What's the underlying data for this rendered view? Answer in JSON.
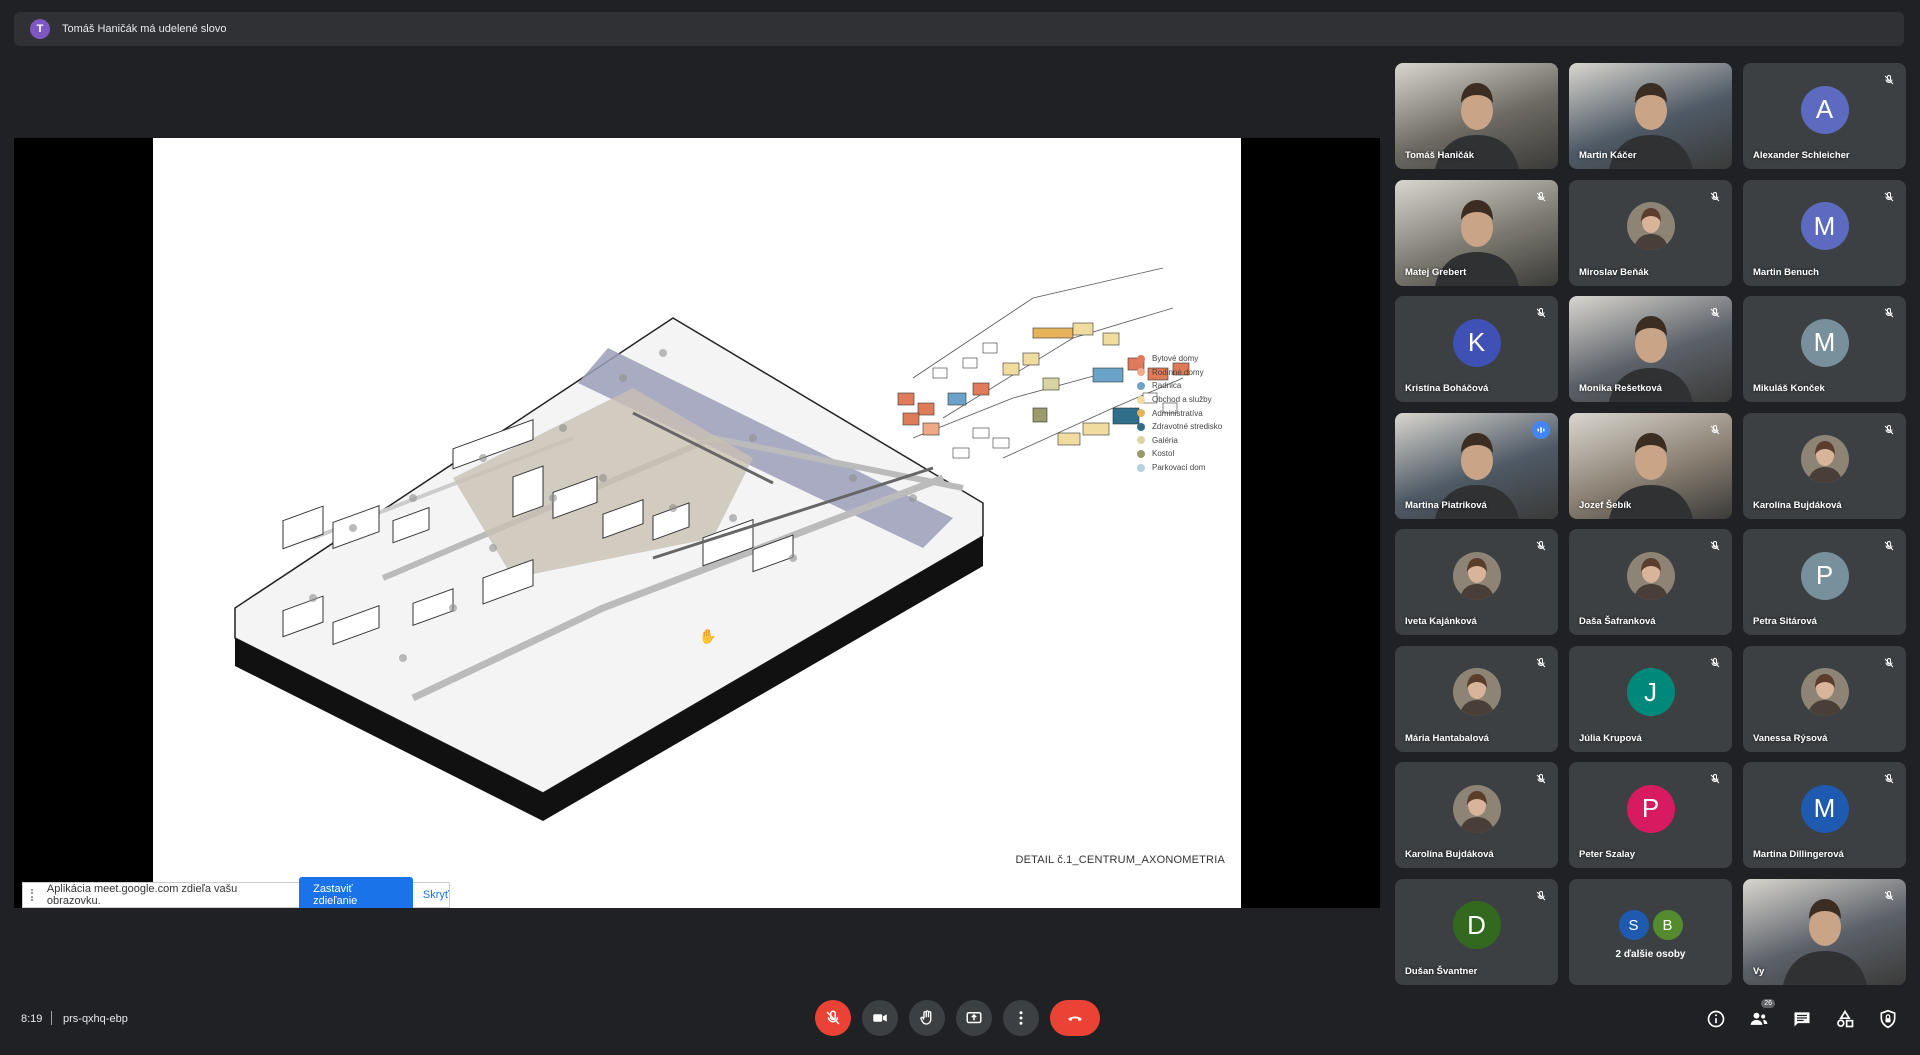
{
  "banner": {
    "avatar_letter": "T",
    "text": "Tomáš Haničák má udelené slovo"
  },
  "slide": {
    "caption": "DETAIL č.1_CENTRUM_AXONOMETRIA",
    "legend": [
      {
        "label": "Bytové domy",
        "color": "#e07b5a"
      },
      {
        "label": "Rodinné domy",
        "color": "#f0a887"
      },
      {
        "label": "Radnica",
        "color": "#6aa3c7"
      },
      {
        "label": "Obchod a služby",
        "color": "#f1dca0"
      },
      {
        "label": "Administratíva",
        "color": "#e6b35a"
      },
      {
        "label": "Zdravotné stredisko",
        "color": "#2f6f8a"
      },
      {
        "label": "Galéria",
        "color": "#d8d3a0"
      },
      {
        "label": "Kostol",
        "color": "#9a9a6a"
      },
      {
        "label": "Parkovací dom",
        "color": "#b6cfdc"
      }
    ]
  },
  "share_bar": {
    "text": "Aplikácia meet.google.com zdieľa vašu obrazovku.",
    "stop_label": "Zastaviť zdieľanie",
    "hide_label": "Skryť"
  },
  "participants": [
    {
      "name": "Tomáš Haničák",
      "type": "video",
      "muted": false
    },
    {
      "name": "Martin Káčer",
      "type": "video",
      "muted": false
    },
    {
      "name": "Alexander Schleicher",
      "type": "letter",
      "letter": "A",
      "color": "#5c6bc0",
      "muted": true
    },
    {
      "name": "Matej Grebert",
      "type": "video",
      "muted": true
    },
    {
      "name": "Miroslav Beňák",
      "type": "photo",
      "muted": true
    },
    {
      "name": "Martin Benuch",
      "type": "letter",
      "letter": "M",
      "color": "#5c6bc0",
      "muted": true
    },
    {
      "name": "Kristína Boháčová",
      "type": "letter",
      "letter": "K",
      "color": "#3f51b5",
      "muted": true
    },
    {
      "name": "Monika Rešetková",
      "type": "video",
      "muted": true
    },
    {
      "name": "Mikuláš Konček",
      "type": "letter",
      "letter": "M",
      "color": "#78909c",
      "muted": true
    },
    {
      "name": "Martina Piatriková",
      "type": "video",
      "muted": false,
      "speaking": true
    },
    {
      "name": "Jozef Šebík",
      "type": "video",
      "muted": true
    },
    {
      "name": "Karolína Bujdáková",
      "type": "photo",
      "muted": true
    },
    {
      "name": "Iveta Kajánková",
      "type": "photo",
      "muted": true
    },
    {
      "name": "Daša Šafranková",
      "type": "photo",
      "muted": true
    },
    {
      "name": "Petra Sitárová",
      "type": "letter",
      "letter": "P",
      "color": "#78909c",
      "muted": true
    },
    {
      "name": "Mária Hantabalová",
      "type": "photo",
      "muted": true
    },
    {
      "name": "Júlia Krupová",
      "type": "letter",
      "letter": "J",
      "color": "#00897b",
      "muted": true
    },
    {
      "name": "Vanessa Rýsová",
      "type": "photo",
      "muted": true
    },
    {
      "name": "Karolína Bujdáková",
      "type": "photo",
      "muted": true
    },
    {
      "name": "Peter Szalay",
      "type": "letter",
      "letter": "P",
      "color": "#d81b60",
      "muted": true
    },
    {
      "name": "Martina Dillingerová",
      "type": "letter",
      "letter": "M",
      "color": "#1e5bb0",
      "muted": true
    },
    {
      "name": "Dušan Švantner",
      "type": "letter",
      "letter": "D",
      "color": "#33691e",
      "muted": true
    },
    {
      "name": "2 ďalšie osoby",
      "type": "more",
      "letters": [
        "S",
        "B"
      ],
      "colors": [
        "#1e5bb0",
        "#558b2f"
      ]
    },
    {
      "name": "Vy",
      "type": "video",
      "muted": true
    }
  ],
  "bottom": {
    "time": "8:19",
    "meeting_code": "prs-qxhq-ebp",
    "people_count": "26"
  }
}
